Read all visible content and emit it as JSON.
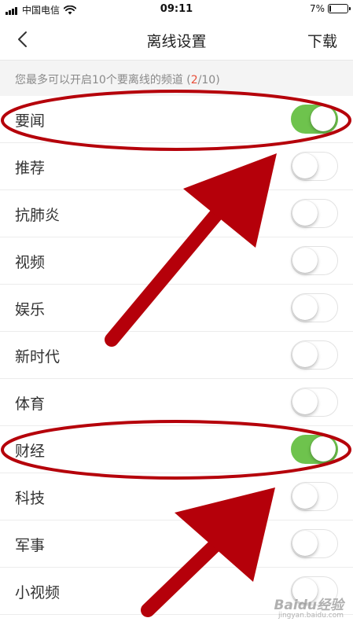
{
  "status_bar": {
    "carrier": "中国电信",
    "time": "09:11",
    "battery_percent": "7%",
    "battery_level": 0.07
  },
  "nav": {
    "title": "离线设置",
    "action_label": "下载",
    "back_icon": "chevron-left-icon"
  },
  "hint": {
    "prefix": "您最多可以开启10个要离线的频道 (",
    "count": "2",
    "suffix": "/10)"
  },
  "channels": [
    {
      "name": "要闻",
      "enabled": true
    },
    {
      "name": "推荐",
      "enabled": false
    },
    {
      "name": "抗肺炎",
      "enabled": false
    },
    {
      "name": "视频",
      "enabled": false
    },
    {
      "name": "娱乐",
      "enabled": false
    },
    {
      "name": "新时代",
      "enabled": false
    },
    {
      "name": "体育",
      "enabled": false
    },
    {
      "name": "财经",
      "enabled": true
    },
    {
      "name": "科技",
      "enabled": false
    },
    {
      "name": "军事",
      "enabled": false
    },
    {
      "name": "小视频",
      "enabled": false
    }
  ],
  "colors": {
    "switch_on": "#6ec34d",
    "annotation_red": "#b5000a",
    "count_highlight": "#e8503a"
  },
  "watermark": {
    "brand": "Baidu经验",
    "sub": "jingyan.baidu.com"
  }
}
